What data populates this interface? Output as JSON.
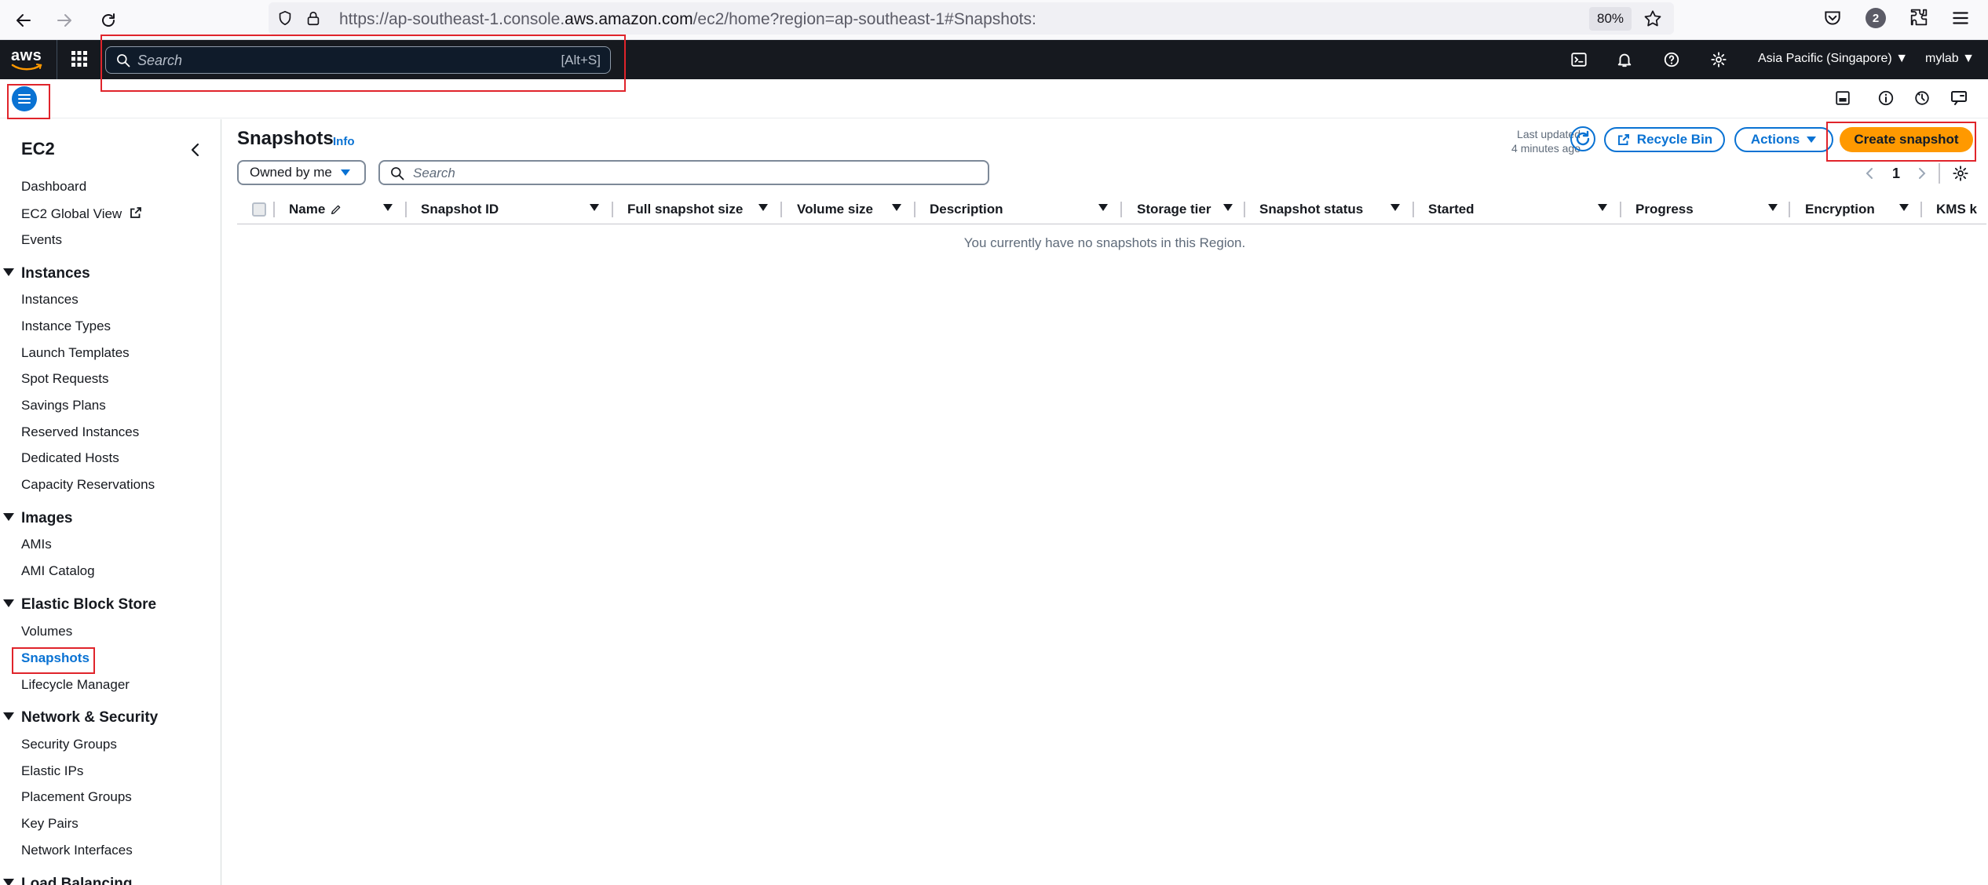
{
  "browser": {
    "url_prefix": "https://ap-southeast-1.console.",
    "url_host": "aws.amazon.com",
    "url_path": "/ec2/home?region=ap-southeast-1#Snapshots:",
    "zoom": "80%",
    "ext_badge": "2"
  },
  "topnav": {
    "logo": "aws",
    "search_placeholder": "Search",
    "search_shortcut": "[Alt+S]",
    "region": "Asia Pacific (Singapore) ▼",
    "account": "mylab ▼"
  },
  "sidebar": {
    "title": "EC2",
    "top_links": [
      "Dashboard",
      "EC2 Global View",
      "Events"
    ],
    "sections": [
      {
        "title": "Instances",
        "items": [
          "Instances",
          "Instance Types",
          "Launch Templates",
          "Spot Requests",
          "Savings Plans",
          "Reserved Instances",
          "Dedicated Hosts",
          "Capacity Reservations"
        ]
      },
      {
        "title": "Images",
        "items": [
          "AMIs",
          "AMI Catalog"
        ]
      },
      {
        "title": "Elastic Block Store",
        "items": [
          "Volumes",
          "Snapshots",
          "Lifecycle Manager"
        ]
      },
      {
        "title": "Network & Security",
        "items": [
          "Security Groups",
          "Elastic IPs",
          "Placement Groups",
          "Key Pairs",
          "Network Interfaces"
        ]
      },
      {
        "title": "Load Balancing",
        "items": []
      }
    ],
    "active_item": "Snapshots"
  },
  "main": {
    "title": "Snapshots",
    "info": "Info",
    "last_updated_label": "Last updated",
    "last_updated_value": "4 minutes ago",
    "recycle_bin": "Recycle Bin",
    "actions": "Actions",
    "create": "Create snapshot",
    "owned_filter": "Owned by me",
    "search_placeholder": "Search",
    "page": "1",
    "columns": [
      "Name",
      "Snapshot ID",
      "Full snapshot size",
      "Volume size",
      "Description",
      "Storage tier",
      "Snapshot status",
      "Started",
      "Progress",
      "Encryption",
      "KMS k"
    ],
    "empty_message": "You currently have no snapshots in this Region."
  },
  "colors": {
    "accent": "#0972d3",
    "primary_button": "#ff9900",
    "annotation": "#e0242b"
  }
}
